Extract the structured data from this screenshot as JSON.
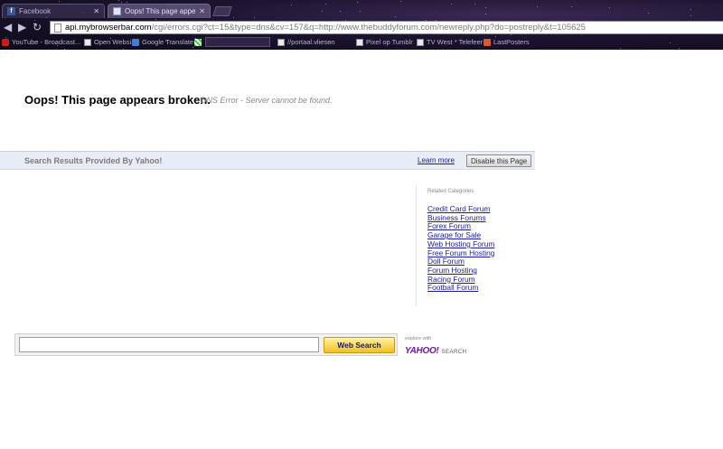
{
  "browser": {
    "tabs": [
      {
        "title": "Facebook",
        "icon": "facebook-icon",
        "active": false
      },
      {
        "title": "Oops! This page appears br...",
        "icon": "page-icon",
        "active": true
      }
    ],
    "url": {
      "host": "api.mybrowserbar.com",
      "path": "/cgi/errors.cgi?ct=15&type=dns&cv=157&q=http://www.thebuddyforum.com/newreply.php?do=postreply&t=105625"
    },
    "bookmarks": [
      {
        "label": "YouTube - Broadcast...",
        "icon": "youtube-icon"
      },
      {
        "label": "Open Websi...",
        "icon": "page-icon"
      },
      {
        "label": "Google Translate",
        "icon": "translate-icon"
      },
      {
        "label": "",
        "icon": "grid-icon"
      },
      {
        "label": "//portaal.vliesen",
        "icon": "page-icon"
      },
      {
        "label": "Pixel op Tumblr",
        "icon": "page-icon"
      },
      {
        "label": "TV West * Telefeer",
        "icon": "page-icon"
      },
      {
        "label": "LastPosters",
        "icon": "lastposters-icon"
      }
    ]
  },
  "error": {
    "heading": "Oops! This page appears broken.",
    "detail": "DNS Error - Server cannot be found."
  },
  "results_bar": {
    "provider": "Search Results Provided By Yahoo!",
    "learn_more": "Learn more",
    "disable_button": "Disable this Page"
  },
  "related": {
    "title": "Related Categories",
    "items": [
      "Credit Card Forum",
      "Business Forums",
      "Forex Forum",
      "Garage for Sale",
      "Web Hosting Forum",
      "Free Forum Hosting",
      "Doll Forum",
      "Forum Hosting",
      "Racing Forum",
      "Football Forum"
    ]
  },
  "search": {
    "input_value": "",
    "button_label": "Web Search"
  },
  "yahoo_brand": {
    "explore": "explore with",
    "logo": "YAHOO!",
    "search_word": "SEARCH"
  }
}
